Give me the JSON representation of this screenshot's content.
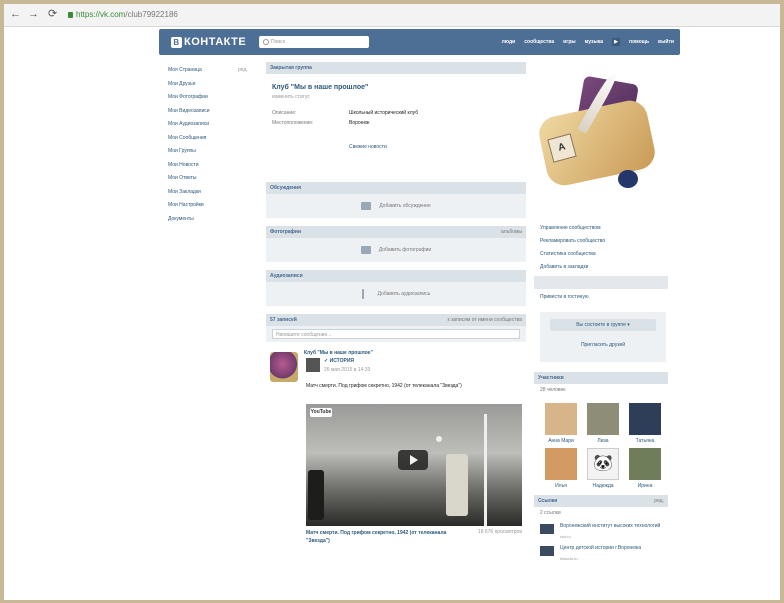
{
  "browser": {
    "url": "https://vk.com/club79922186",
    "url_host": "https://vk.com",
    "url_path": "/club79922186"
  },
  "header": {
    "logo": "КОНТАКТЕ",
    "logo_badge": "В",
    "search_placeholder": "Поиск",
    "nav": [
      "люди",
      "сообщества",
      "игры",
      "музыка",
      "помощь",
      "выйти"
    ]
  },
  "sidebar": {
    "edit_label": "ред.",
    "items": [
      "Моя Страница",
      "Мои Друзья",
      "Мои Фотографии",
      "Мои Видеозаписи",
      "Мои Аудиозаписи",
      "Мои Сообщения",
      "Мои Группы",
      "Мои Новости",
      "Мои Ответы",
      "Мои Закладки",
      "Мои Настройки",
      "Документы"
    ]
  },
  "group": {
    "type_label": "Закрытая группа",
    "title": "Клуб \"Мы в наше прошлое\"",
    "status": "изменить статус",
    "info": [
      {
        "key": "Описание:",
        "value": "Школьный исторический клуб"
      },
      {
        "key": "Местоположение:",
        "value": "Воронеж"
      }
    ],
    "news_link": "Свежие новости"
  },
  "sections": {
    "discussions": {
      "title": "Обсуждения",
      "empty": "Добавить обсуждение"
    },
    "photos": {
      "title": "Фотографии",
      "right": "альбомы",
      "empty": "Добавить фотографии"
    },
    "audio": {
      "title": "Аудиозаписи",
      "empty": "Добавить аудиозапись"
    }
  },
  "wall": {
    "count": "57 записей",
    "filter": "к записям от имени сообщества",
    "composer_placeholder": "Напишите сообщение...",
    "post": {
      "author": "Клуб \"Мы в наше прошлое\"",
      "repost_name": "ИСТОРИЯ",
      "date": "26 мая 2015 в 14:33",
      "text": "Матч смерти. Под грифом секретно, 1942 (от телеканала \"Звезда\")",
      "video_brand": "YouTube",
      "video_caption": "Матч смерти. Под грифом секретно, 1942 (от телеканала \"Звезда\")",
      "video_views": "18 676 просмотров"
    }
  },
  "right": {
    "actions": [
      "Управление сообществом",
      "Рекламировать сообщество",
      "Статистика сообщества",
      "Добавить в закладки"
    ],
    "mention": "Привести в гостиную",
    "subscribed": "Вы состоите в группе",
    "invite": "Пригласить друзей",
    "members_title": "Участники",
    "members_count": "28 человек",
    "members": [
      {
        "name": "Анна Мари",
        "color": "#d8b48a"
      },
      {
        "name": "Лиза",
        "color": "#8e8e78"
      },
      {
        "name": "Татьяна",
        "color": "#2f3e58"
      },
      {
        "name": "Илья",
        "color": "#d39a63"
      },
      {
        "name": "Надежда",
        "color": "#f3f3f3"
      },
      {
        "name": "Ирина",
        "color": "#6f7d5a"
      }
    ],
    "links_title": "Ссылки",
    "links_edit": "ред.",
    "links_count": "2 ссылки",
    "links": [
      {
        "text": "Воронежский институт высоких технологий",
        "sub": "vivt.ru"
      },
      {
        "text": "Центр детской истории г.Воронежа",
        "sub": "historia.ru"
      }
    ]
  },
  "colors": {
    "brand": "#4d6f95",
    "link": "#2b587a",
    "bar": "#dae2e8",
    "panel": "#eef1f4"
  }
}
